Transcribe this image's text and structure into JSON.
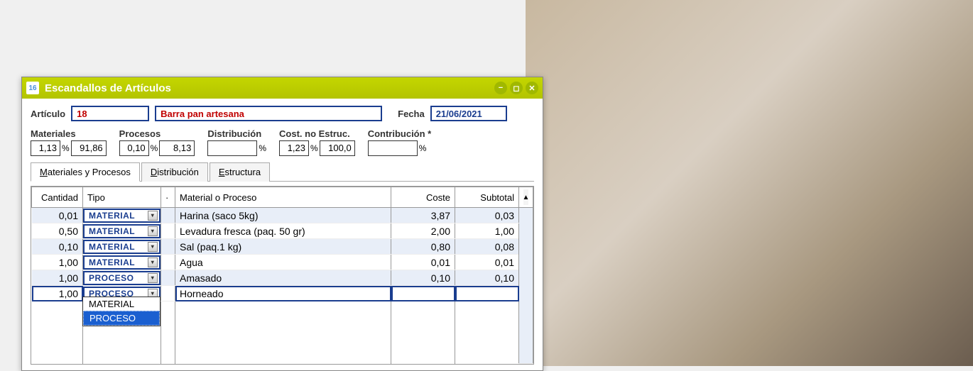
{
  "titlebar": {
    "icon_text": "16",
    "title": "Escandallos de Artículos"
  },
  "form": {
    "articulo_label": "Artículo",
    "articulo_code": "18",
    "articulo_name": "Barra pan artesana",
    "fecha_label": "Fecha",
    "fecha_value": "21/06/2021"
  },
  "stats": {
    "materiales_label": "Materiales",
    "materiales_v1": "1,13",
    "materiales_v2": "91,86",
    "procesos_label": "Procesos",
    "procesos_v1": "0,10",
    "procesos_v2": "8,13",
    "distribucion_label": "Distribución",
    "distribucion_v1": "",
    "cost_label": "Cost. no Estruc.",
    "cost_v1": "1,23",
    "cost_v2": "100,0",
    "contrib_label": "Contribución *",
    "contrib_v1": ""
  },
  "tabs": {
    "t1": "Materiales y Procesos",
    "t2": "Distribución",
    "t3": "Estructura"
  },
  "columns": {
    "cantidad": "Cantidad",
    "tipo": "Tipo",
    "blank": "",
    "material": "Material o Proceso",
    "coste": "Coste",
    "subtotal": "Subtotal"
  },
  "rows": [
    {
      "qty": "0,01",
      "tipo": "MATERIAL",
      "mat": "Harina (saco 5kg)",
      "coste": "3,87",
      "sub": "0,03"
    },
    {
      "qty": "0,50",
      "tipo": "MATERIAL",
      "mat": "Levadura fresca  (paq. 50 gr)",
      "coste": "2,00",
      "sub": "1,00"
    },
    {
      "qty": "0,10",
      "tipo": "MATERIAL",
      "mat": "Sal (paq.1 kg)",
      "coste": "0,80",
      "sub": "0,08"
    },
    {
      "qty": "1,00",
      "tipo": "MATERIAL",
      "mat": "Agua",
      "coste": "0,01",
      "sub": "0,01"
    },
    {
      "qty": "1,00",
      "tipo": "PROCESO",
      "mat": "Amasado",
      "coste": "0,10",
      "sub": "0,10"
    },
    {
      "qty": "1,00",
      "tipo": "PROCESO",
      "mat": "Horneado",
      "coste": "",
      "sub": ""
    }
  ],
  "dropdown": {
    "opt1": "MATERIAL",
    "opt2": "PROCESO"
  }
}
